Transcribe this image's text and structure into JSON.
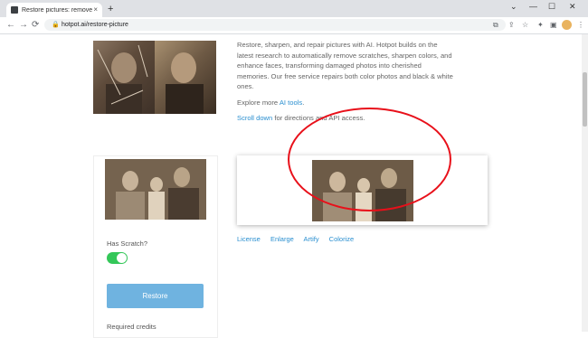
{
  "browser": {
    "tab_title": "Restore pictures: remove scratch",
    "tab_close": "×",
    "new_tab": "+",
    "url": "hotpot.ai/restore-picture",
    "back": "←",
    "forward": "→",
    "reload": "⟳",
    "lock": "🔒",
    "minimize": "—",
    "maximize": "☐",
    "close": "✕",
    "toolbar_icons": [
      "⧉",
      "⇪",
      "☆",
      "✦",
      "▣",
      "⋮"
    ]
  },
  "intro": {
    "paragraph1": "Restore, sharpen, and repair pictures with AI. Hotpot builds on the latest research to automatically remove scratches, sharpen colors, and enhance faces, transforming damaged photos into cherished memories. Our free service repairs both color photos and black & white ones.",
    "explore_prefix": "Explore more ",
    "explore_link": "AI tools",
    "explore_suffix": ".",
    "scroll_link": "Scroll down",
    "scroll_suffix": " for directions and API access."
  },
  "controls": {
    "has_scratch_label": "Has Scratch?",
    "has_scratch_on": true,
    "restore_button": "Restore",
    "required_credits_label": "Required credits"
  },
  "result": {
    "actions": [
      "License",
      "Enlarge",
      "Artify",
      "Colorize"
    ]
  },
  "colors": {
    "accent_blue": "#2a8fd0",
    "button_blue": "#6fb3e0",
    "toggle_green": "#34c759",
    "annotation_red": "#e8101a"
  }
}
